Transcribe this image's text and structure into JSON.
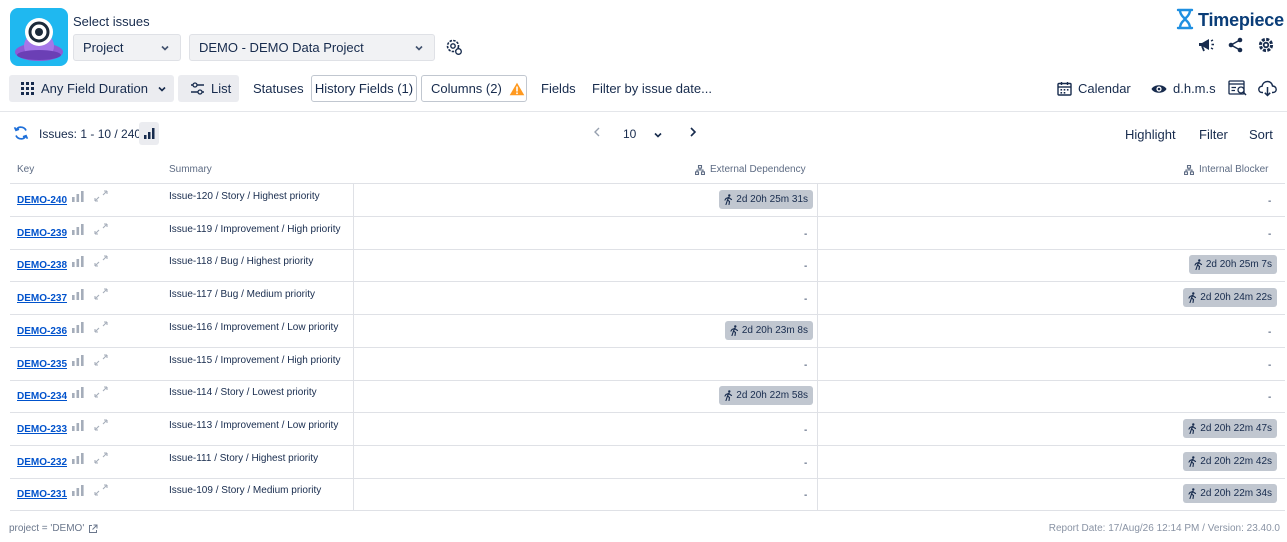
{
  "header": {
    "select_title": "Select issues",
    "project_select": "Project",
    "data_select": "DEMO - DEMO Data Project",
    "brand": "Timepiece",
    "brand_color": "#0a3d78",
    "logo_bg": "#1fb8f0"
  },
  "toolbar": {
    "duration_label": "Any Field Duration",
    "list_label": "List",
    "statuses_label": "Statuses",
    "history_fields_label": "History Fields (1)",
    "columns_label": "Columns (2)",
    "fields_label": "Fields",
    "filter_date_label": "Filter by issue date...",
    "calendar_label": "Calendar",
    "format_label": "d.h.m.s",
    "icons": [
      "grid-icon",
      "sliders-icon",
      "warning-icon",
      "calendar-icon",
      "eye-icon",
      "report-icon",
      "cloud-download-icon"
    ]
  },
  "issues_bar": {
    "count": "Issues: 1 - 10 / 240",
    "page_size": "10",
    "highlight": "Highlight",
    "filter": "Filter",
    "sort": "Sort"
  },
  "table": {
    "headers": {
      "key": "Key",
      "summary": "Summary",
      "external": "External Dependency",
      "internal": "Internal Blocker"
    },
    "rows": [
      {
        "key": "DEMO-240",
        "summary": "Issue-120 / Story / Highest priority",
        "external": "2d 20h 25m 31s",
        "internal": "-"
      },
      {
        "key": "DEMO-239",
        "summary": "Issue-119 / Improvement / High priority",
        "external": "-",
        "internal": "-"
      },
      {
        "key": "DEMO-238",
        "summary": "Issue-118 / Bug / Highest priority",
        "external": "-",
        "internal": "2d 20h 25m 7s"
      },
      {
        "key": "DEMO-237",
        "summary": "Issue-117 / Bug / Medium priority",
        "external": "-",
        "internal": "2d 20h 24m 22s"
      },
      {
        "key": "DEMO-236",
        "summary": "Issue-116 / Improvement / Low priority",
        "external": "2d 20h 23m 8s",
        "internal": "-"
      },
      {
        "key": "DEMO-235",
        "summary": "Issue-115 / Improvement / High priority",
        "external": "-",
        "internal": "-"
      },
      {
        "key": "DEMO-234",
        "summary": "Issue-114 / Story / Lowest priority",
        "external": "2d 20h 22m 58s",
        "internal": "-"
      },
      {
        "key": "DEMO-233",
        "summary": "Issue-113 / Improvement / Low priority",
        "external": "-",
        "internal": "2d 20h 22m 47s"
      },
      {
        "key": "DEMO-232",
        "summary": "Issue-111 / Story / Highest priority",
        "external": "-",
        "internal": "2d 20h 22m 42s"
      },
      {
        "key": "DEMO-231",
        "summary": "Issue-109 / Story / Medium priority",
        "external": "-",
        "internal": "2d 20h 22m 34s"
      }
    ]
  },
  "footer": {
    "query": "project = 'DEMO'",
    "report": "Report Date: 17/Aug/26 12:14 PM / Version: 23.40.0"
  }
}
